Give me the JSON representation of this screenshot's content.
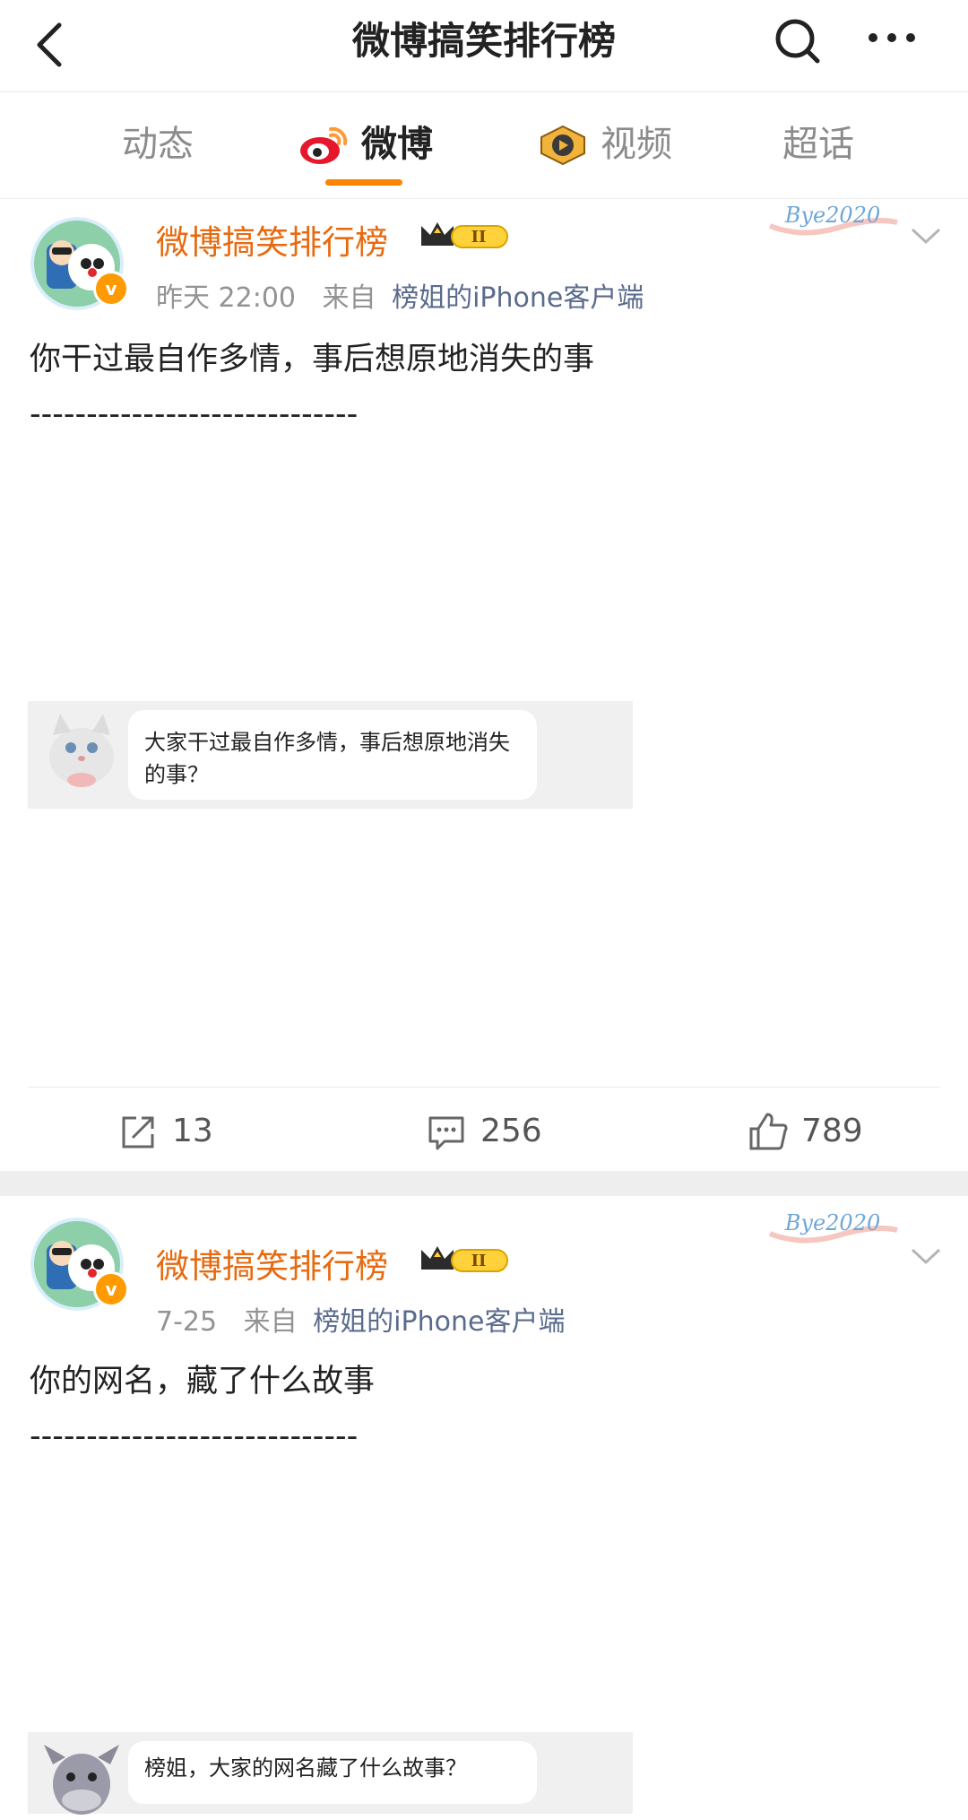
{
  "nav": {
    "title": "微博搞笑排行榜"
  },
  "tabs": [
    "动态",
    "微博",
    "视频",
    "超话"
  ],
  "posts": [
    {
      "username": "微博搞笑排行榜",
      "time": "昨天 22:00",
      "from": "来自",
      "source": "榜姐的iPhone客户端",
      "text": "你干过最自作多情，事后想原地消失的事",
      "divider": "-----------------------------",
      "quote": "大家干过最自作多情，事后想原地消失的事？",
      "reposts": "13",
      "comments": "256",
      "likes": "789"
    },
    {
      "username": "微博搞笑排行榜",
      "time": "7-25",
      "from": "来自",
      "source": "榜姐的iPhone客户端",
      "text": "你的网名，藏了什么故事",
      "divider": "-----------------------------",
      "quote": "榜姐，大家的网名藏了什么故事？"
    }
  ],
  "badges": {
    "level": "II",
    "decoration": "Bye2020"
  },
  "colors": {
    "accent": "#ff8200",
    "username": "#e86a10",
    "source_link": "#5a6b8c"
  }
}
